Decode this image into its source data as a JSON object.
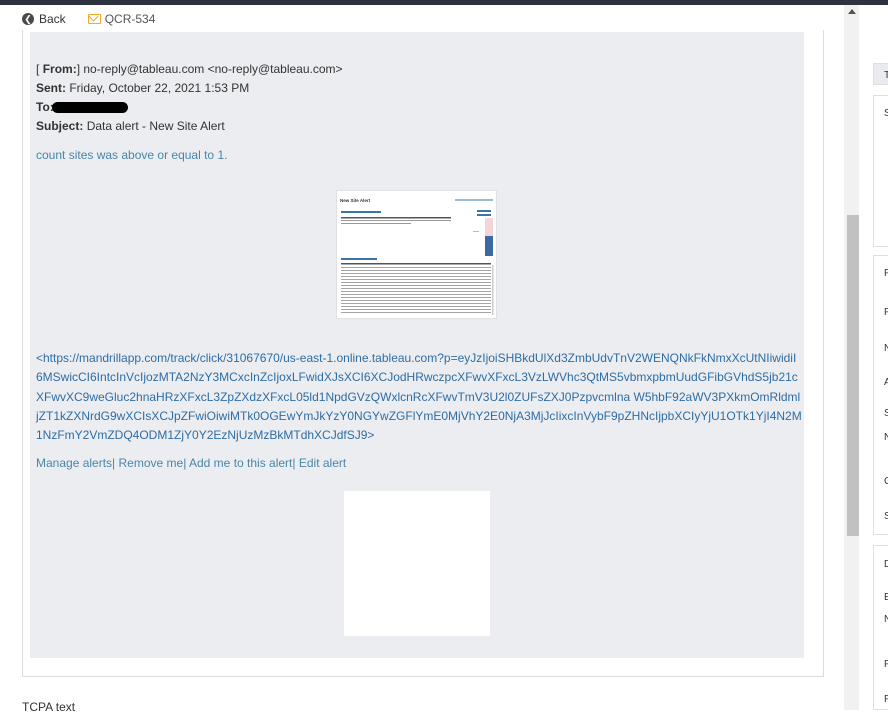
{
  "nav": {
    "back_label": "Back",
    "ticket_id": "QCR-534"
  },
  "email": {
    "from_label": "From:",
    "from_prefix": "[",
    "from_bracket": "]",
    "from_value": "no-reply@tableau.com <no-reply@tableau.com>",
    "sent_label": "Sent:",
    "sent_value": "Friday, October 22, 2021 1:53 PM",
    "to_label": "To:",
    "subject_label": "Subject:",
    "subject_value": "Data alert - New Site Alert",
    "alert_message": "count sites was above or equal to 1.",
    "preview_title": "New Site Alert",
    "tracking_link": "<https://mandrillapp.com/track/click/31067670/us-east-1.online.tableau.com?p=eyJzIjoiSHBkdUlXd3ZmbUdvTnV2WENQNkFkNmxXcUtNIiwidiI6MSwicCI6IntcInVcIjozMTA2NzY3MCxcInZcIjoxLFwidXJsXCI6XCJodHRwczpcXFwvXFxcL3VzLWVhc3QtMS5vbmxpbmUudGFibGVhdS5jb21cXFwvXC9weGluc2hnaHRzXFxcL3ZpZXdzXFxcL05ld1NpdGVzQWxlcnRcXFwvTmV3U2l0ZUFsZXJ0Pzpvcmlna W5hbF92aWV3PXkmOmRldmljZT1kZXNrdG9wXCIsXCJpZFwiOiwiMTk0OGEwYmJkYzY0NGYwZGFlYmE0MjVhY2E0NjA3MjJcIixcInVybF9pZHNcIjpbXCIyYjU1OTk1YjI4N2M1NzFmY2VmZDQ4ODM1ZjY0Y2EzNjUzMzBkMTdhXCJdfSJ9>",
    "manage_alerts": "Manage alerts",
    "remove_me": "Remove me",
    "add_me": "Add me to this alert",
    "edit_alert": "Edit alert",
    "link_separator": "|"
  },
  "footer": {
    "tcpa_label": "TCPA text"
  },
  "right_panel": {
    "letters": [
      "T",
      "S",
      "F",
      "F",
      "N",
      "A",
      "S",
      "N",
      "C",
      "S",
      "D",
      "E",
      "N",
      "F",
      "F"
    ]
  }
}
